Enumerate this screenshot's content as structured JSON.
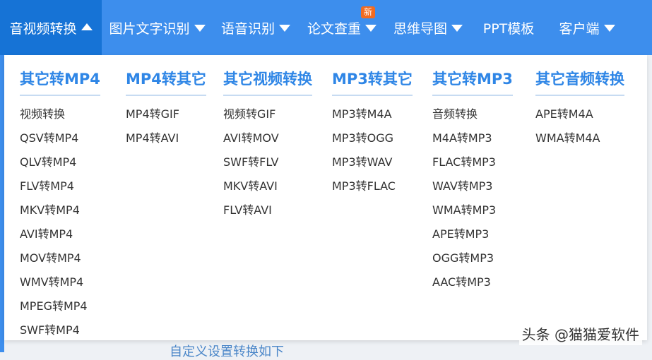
{
  "nav": [
    {
      "label": "音视频转换",
      "active": true
    },
    {
      "label": "图片文字识别"
    },
    {
      "label": "语音识别"
    },
    {
      "label": "论文查重",
      "badge": "新"
    },
    {
      "label": "思维导图"
    },
    {
      "label": "PPT模板"
    },
    {
      "label": "客户端"
    }
  ],
  "columns": [
    {
      "header": "其它转MP4",
      "items": [
        "视频转换",
        "QSV转MP4",
        "QLV转MP4",
        "FLV转MP4",
        "MKV转MP4",
        "AVI转MP4",
        "MOV转MP4",
        "WMV转MP4",
        "MPEG转MP4",
        "SWF转MP4"
      ]
    },
    {
      "header": "MP4转其它",
      "items": [
        "MP4转GIF",
        "MP4转AVI"
      ]
    },
    {
      "header": "其它视频转换",
      "items": [
        "视频转GIF",
        "AVI转MOV",
        "SWF转FLV",
        "MKV转AVI",
        "FLV转AVI"
      ]
    },
    {
      "header": "MP3转其它",
      "items": [
        "MP3转M4A",
        "MP3转OGG",
        "MP3转WAV",
        "MP3转FLAC"
      ]
    },
    {
      "header": "其它转MP3",
      "items": [
        "音频转换",
        "M4A转MP3",
        "FLAC转MP3",
        "WAV转MP3",
        "WMA转MP3",
        "APE转MP3",
        "OGG转MP3",
        "AAC转MP3"
      ]
    },
    {
      "header": "其它音频转换",
      "items": [
        "APE转M4A",
        "WMA转M4A"
      ]
    }
  ],
  "background_text": "自定义设置转换如下",
  "watermark": "头条 @猫猫爱软件",
  "colors": {
    "navbar": "#3d8eed",
    "nav_active": "#1673d6",
    "header": "#2f86e6",
    "badge": "#f26b21"
  }
}
